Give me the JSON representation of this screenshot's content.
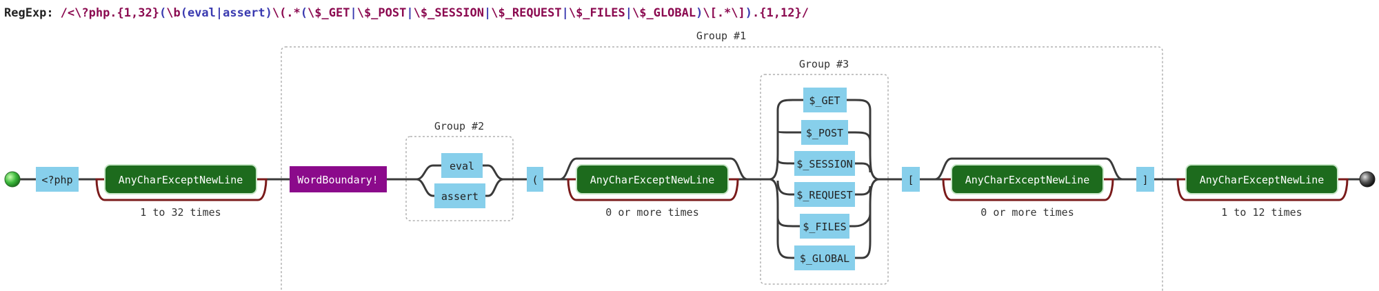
{
  "regexp": {
    "label": "RegExp:",
    "tokens": [
      {
        "text": "/<\\?php.",
        "color": "#8b0a50"
      },
      {
        "text": "{1,32}",
        "color": "#8b0a50"
      },
      {
        "text": "(",
        "color": "#3a3ab0"
      },
      {
        "text": "\\b",
        "color": "#8b0a50"
      },
      {
        "text": "(",
        "color": "#3a3ab0"
      },
      {
        "text": "eval",
        "color": "#3a3ab0"
      },
      {
        "text": "|",
        "color": "#3a3ab0"
      },
      {
        "text": "assert",
        "color": "#3a3ab0"
      },
      {
        "text": ")",
        "color": "#3a3ab0"
      },
      {
        "text": "\\(.*",
        "color": "#8b0a50"
      },
      {
        "text": "(",
        "color": "#3a3ab0"
      },
      {
        "text": "\\$_GET",
        "color": "#8b0a50"
      },
      {
        "text": "|",
        "color": "#3a3ab0"
      },
      {
        "text": "\\$_POST",
        "color": "#8b0a50"
      },
      {
        "text": "|",
        "color": "#3a3ab0"
      },
      {
        "text": "\\$_SESSION",
        "color": "#8b0a50"
      },
      {
        "text": "|",
        "color": "#3a3ab0"
      },
      {
        "text": "\\$_REQUEST",
        "color": "#8b0a50"
      },
      {
        "text": "|",
        "color": "#3a3ab0"
      },
      {
        "text": "\\$_FILES",
        "color": "#8b0a50"
      },
      {
        "text": "|",
        "color": "#3a3ab0"
      },
      {
        "text": "\\$_GLOBAL",
        "color": "#8b0a50"
      },
      {
        "text": ")",
        "color": "#3a3ab0"
      },
      {
        "text": "\\[.*\\]",
        "color": "#8b0a50"
      },
      {
        "text": ")",
        "color": "#3a3ab0"
      },
      {
        "text": ".",
        "color": "#8b0a50"
      },
      {
        "text": "{1,12}",
        "color": "#8b0a50"
      },
      {
        "text": "/",
        "color": "#8b0a50"
      }
    ]
  },
  "groups": {
    "group1": "Group #1",
    "group2": "Group #2",
    "group3": "Group #3"
  },
  "nodes": {
    "php_literal": "<?php",
    "any1": "AnyCharExceptNewLine",
    "word_boundary": "WordBoundary!",
    "alt_eval": "eval",
    "alt_assert": "assert",
    "paren_literal": "(",
    "any2": "AnyCharExceptNewLine",
    "opt_get": "$_GET",
    "opt_post": "$_POST",
    "opt_session": "$_SESSION",
    "opt_request": "$_REQUEST",
    "opt_files": "$_FILES",
    "opt_global": "$_GLOBAL",
    "bracket_open": "[",
    "any3": "AnyCharExceptNewLine",
    "bracket_close": "]",
    "any4": "AnyCharExceptNewLine"
  },
  "repeats": {
    "r1": "1 to 32 times",
    "r2": "0 or more times",
    "r3": "0 or more times",
    "r4": "1 to 12 times"
  },
  "colors": {
    "literal_fill": "#87cfeb",
    "any_fill": "#1d6b1d",
    "any_border": "#c7e6c7",
    "word_boundary_fill": "#8b0a8b",
    "line": "#3a3a3a",
    "repeat_line": "#7a1a1a",
    "group_border": "#b0b0b0"
  }
}
